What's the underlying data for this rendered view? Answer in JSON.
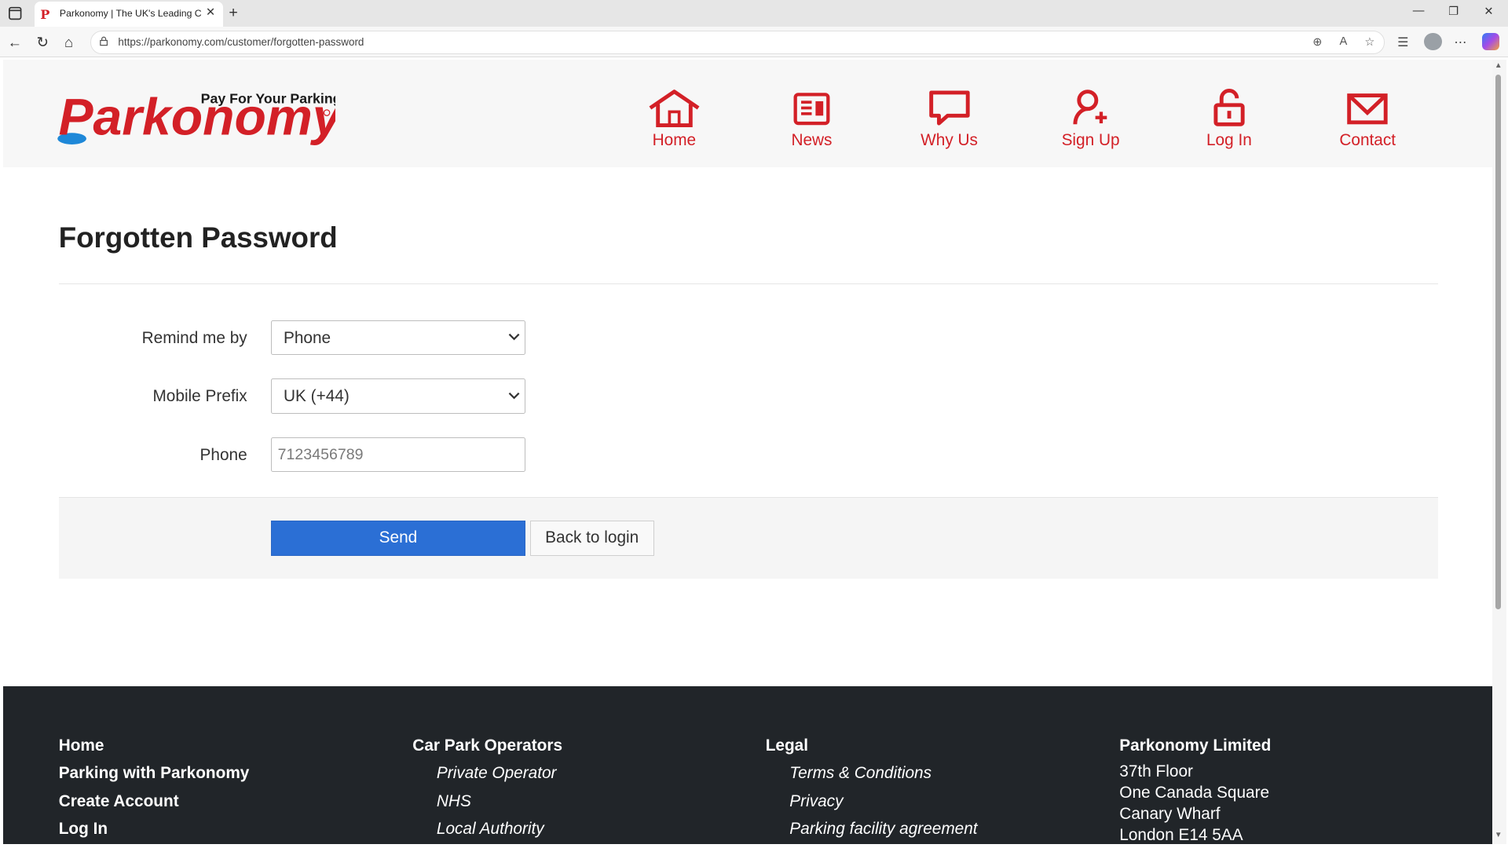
{
  "browser": {
    "tab_title": "Parkonomy | The UK's Leading Car Park Payment",
    "url": "https://parkonomy.com/customer/forgotten-password"
  },
  "header": {
    "logo_tagline": "Pay For Your Parking With",
    "logo_text": "Parkonomy",
    "nav": [
      {
        "label": "Home",
        "icon": "home-icon"
      },
      {
        "label": "News",
        "icon": "news-icon"
      },
      {
        "label": "Why Us",
        "icon": "speech-bubble-icon"
      },
      {
        "label": "Sign Up",
        "icon": "add-user-icon"
      },
      {
        "label": "Log In",
        "icon": "unlock-icon"
      },
      {
        "label": "Contact",
        "icon": "envelope-icon"
      }
    ]
  },
  "form": {
    "title": "Forgotten Password",
    "remind_label": "Remind me by",
    "remind_value": "Phone",
    "prefix_label": "Mobile Prefix",
    "prefix_value": "UK (+44)",
    "phone_label": "Phone",
    "phone_placeholder": "7123456789",
    "send_label": "Send",
    "back_label": "Back to login"
  },
  "footer": {
    "col1": [
      "Home",
      "Parking with Parkonomy",
      "Create Account",
      "Log In"
    ],
    "col2": {
      "heading": "Car Park Operators",
      "links": [
        "Private Operator",
        "NHS",
        "Local Authority"
      ]
    },
    "col3": {
      "heading": "Legal",
      "links": [
        "Terms & Conditions",
        "Privacy",
        "Parking facility agreement"
      ]
    },
    "col4": {
      "heading": "Parkonomy Limited",
      "lines": [
        "37th Floor",
        "One Canada Square",
        "Canary Wharf",
        "London E14 5AA"
      ]
    }
  },
  "colors": {
    "brand_red": "#d32027",
    "button_blue": "#2b6fd5",
    "footer_bg": "#212529"
  }
}
